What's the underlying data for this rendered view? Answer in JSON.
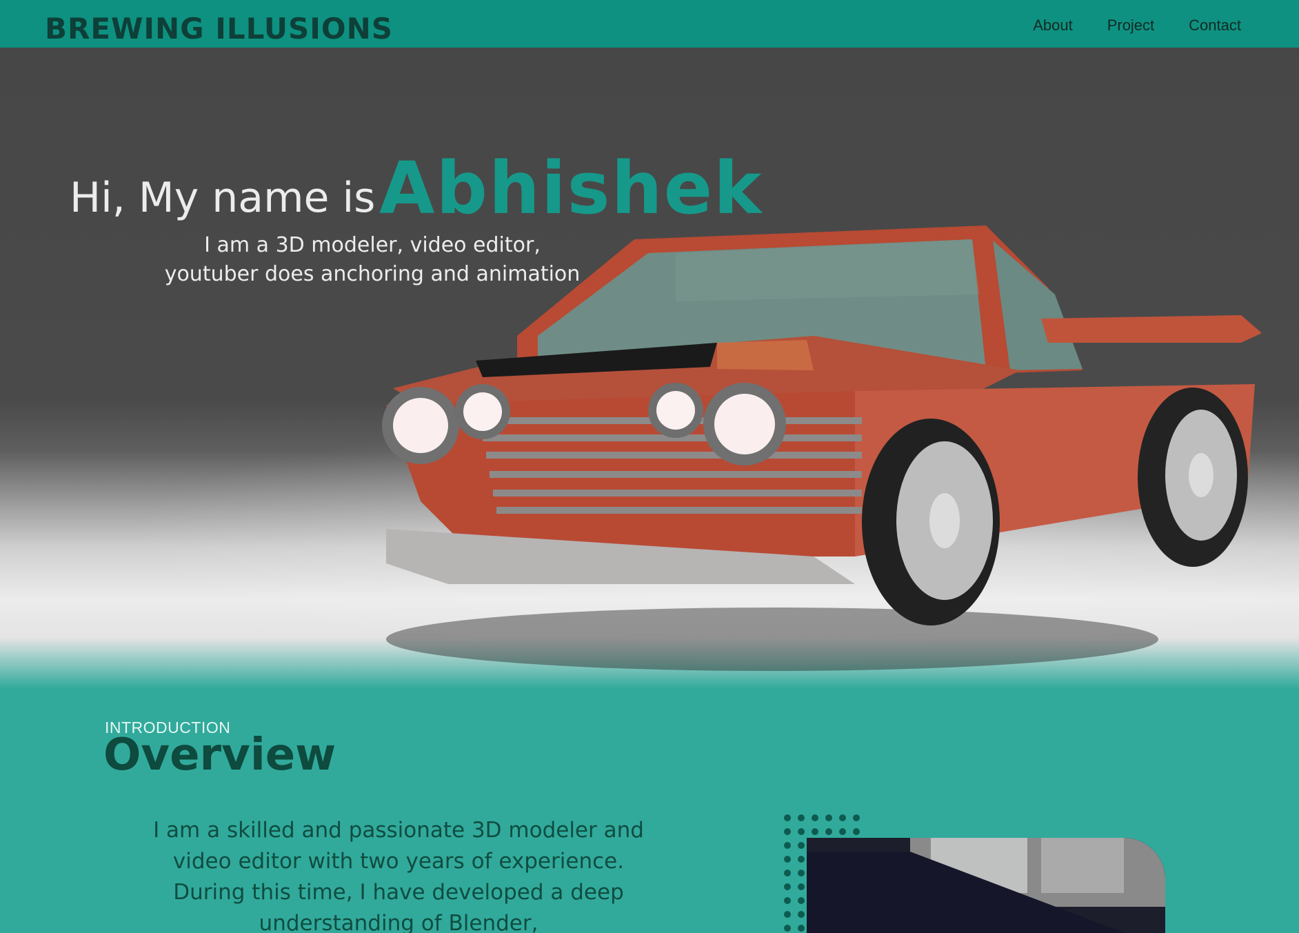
{
  "nav": {
    "brand": "BREWING ILLUSIONS",
    "links": [
      "About",
      "Project",
      "Contact"
    ]
  },
  "hero": {
    "greeting": "Hi, My name is",
    "name": "Abhishek",
    "tagline_line1": "I am a 3D modeler, video editor,",
    "tagline_line2": "youtuber  does anchoring and animation"
  },
  "overview": {
    "label": "INTRODUCTION",
    "title": "Overview",
    "body": "I am a skilled and passionate 3D modeler and video editor with two years of experience. During this time, I have developed a deep understanding of Blender,"
  },
  "colors": {
    "nav_bg": "#0e9180",
    "hero_bg": "#474747",
    "accent": "#16998a",
    "section_bg": "#31aa9c",
    "car_body": "#c8573f"
  }
}
